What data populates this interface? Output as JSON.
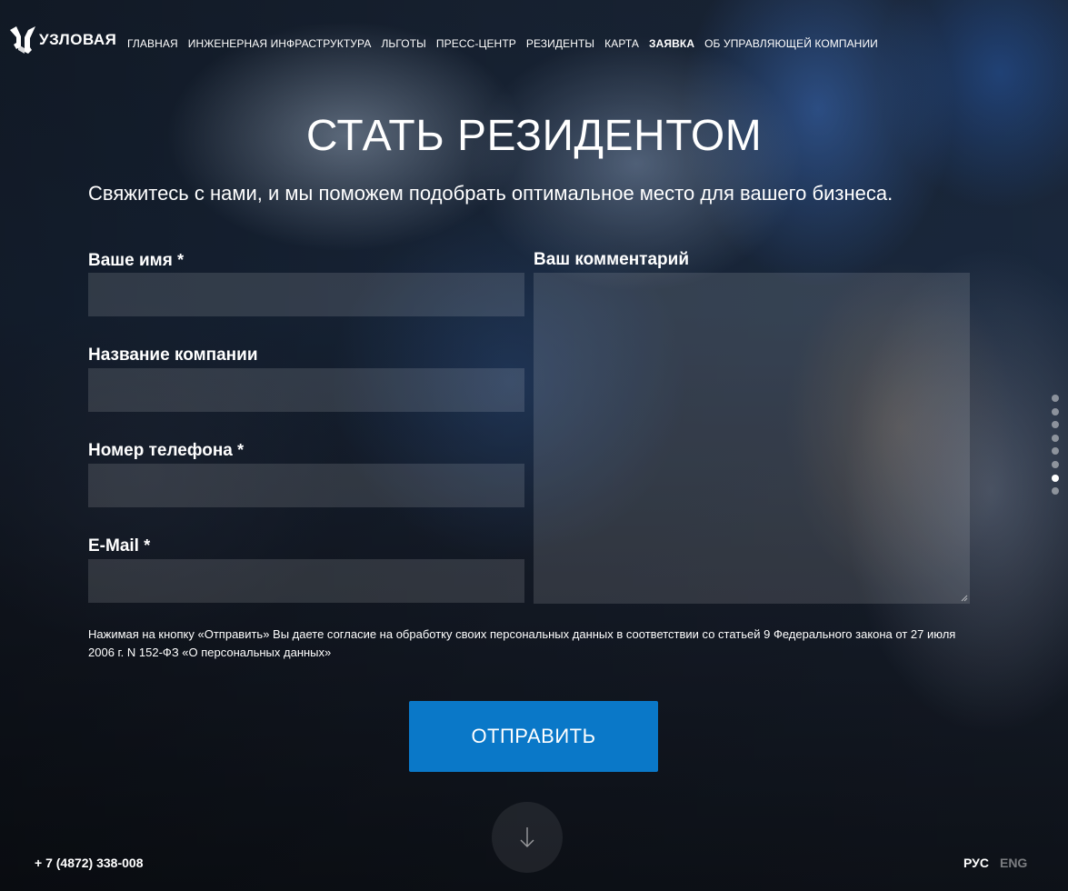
{
  "header": {
    "logo_text": "УЗЛОВАЯ",
    "nav": [
      {
        "label": "ГЛАВНАЯ",
        "active": false
      },
      {
        "label": "ИНЖЕНЕРНАЯ ИНФРАСТРУКТУРА",
        "active": false
      },
      {
        "label": "ЛЬГОТЫ",
        "active": false
      },
      {
        "label": "ПРЕСС-ЦЕНТР",
        "active": false
      },
      {
        "label": "РЕЗИДЕНТЫ",
        "active": false
      },
      {
        "label": "КАРТА",
        "active": false
      },
      {
        "label": "ЗАЯВКА",
        "active": true
      },
      {
        "label": "ОБ УПРАВЛЯЮЩЕЙ КОМПАНИИ",
        "active": false
      }
    ]
  },
  "main": {
    "title": "СТАТЬ РЕЗИДЕНТОМ",
    "subtitle": "Свяжитесь с нами, и мы поможем подобрать оптимальное место для вашего бизнеса."
  },
  "form": {
    "name_label": "Ваше имя",
    "name_required": "*",
    "name_value": "",
    "company_label": "Название компании",
    "company_value": "",
    "phone_label": "Номер телефона",
    "phone_required": "*",
    "phone_value": "",
    "email_label": "E-Mail",
    "email_required": "*",
    "email_value": "",
    "comment_label": "Ваш комментарий",
    "comment_value": "",
    "consent": "Нажимая на кнопку «Отправить» Вы даете согласие на обработку своих персональных данных в соответствии со статьей 9 Федерального закона от 27 июля 2006 г. N 152-ФЗ «О персональных данных»",
    "submit_label": "ОТПРАВИТЬ"
  },
  "footer": {
    "phone": "+ 7 (4872) 338-008",
    "lang_rus": "РУС",
    "lang_eng": "ENG"
  },
  "pager": {
    "total": 8,
    "active_index": 6
  }
}
